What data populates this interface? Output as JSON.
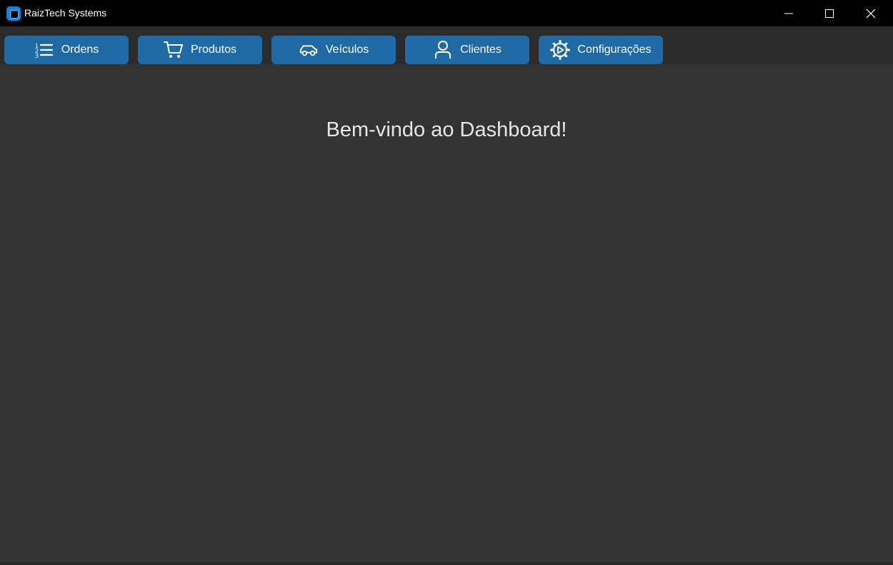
{
  "window": {
    "title": "RaizTech Systems",
    "logo_icon": "app-logo-icon",
    "controls": [
      "minimize-icon",
      "maximize-icon",
      "close-icon"
    ]
  },
  "nav": {
    "items": [
      {
        "label": "Ordens",
        "icon": "list-icon"
      },
      {
        "label": "Produtos",
        "icon": "cart-icon"
      },
      {
        "label": "Veículos",
        "icon": "car-icon"
      },
      {
        "label": "Clientes",
        "icon": "user-icon"
      },
      {
        "label": "Configurações",
        "icon": "gear-icon"
      }
    ]
  },
  "main": {
    "welcome": "Bem-vindo ao Dashboard!"
  },
  "colors": {
    "titlebar": "#000000",
    "navbar": "#2b2b2b",
    "background": "#333333",
    "button": "#1f6aa5",
    "text": "#ffffff"
  }
}
